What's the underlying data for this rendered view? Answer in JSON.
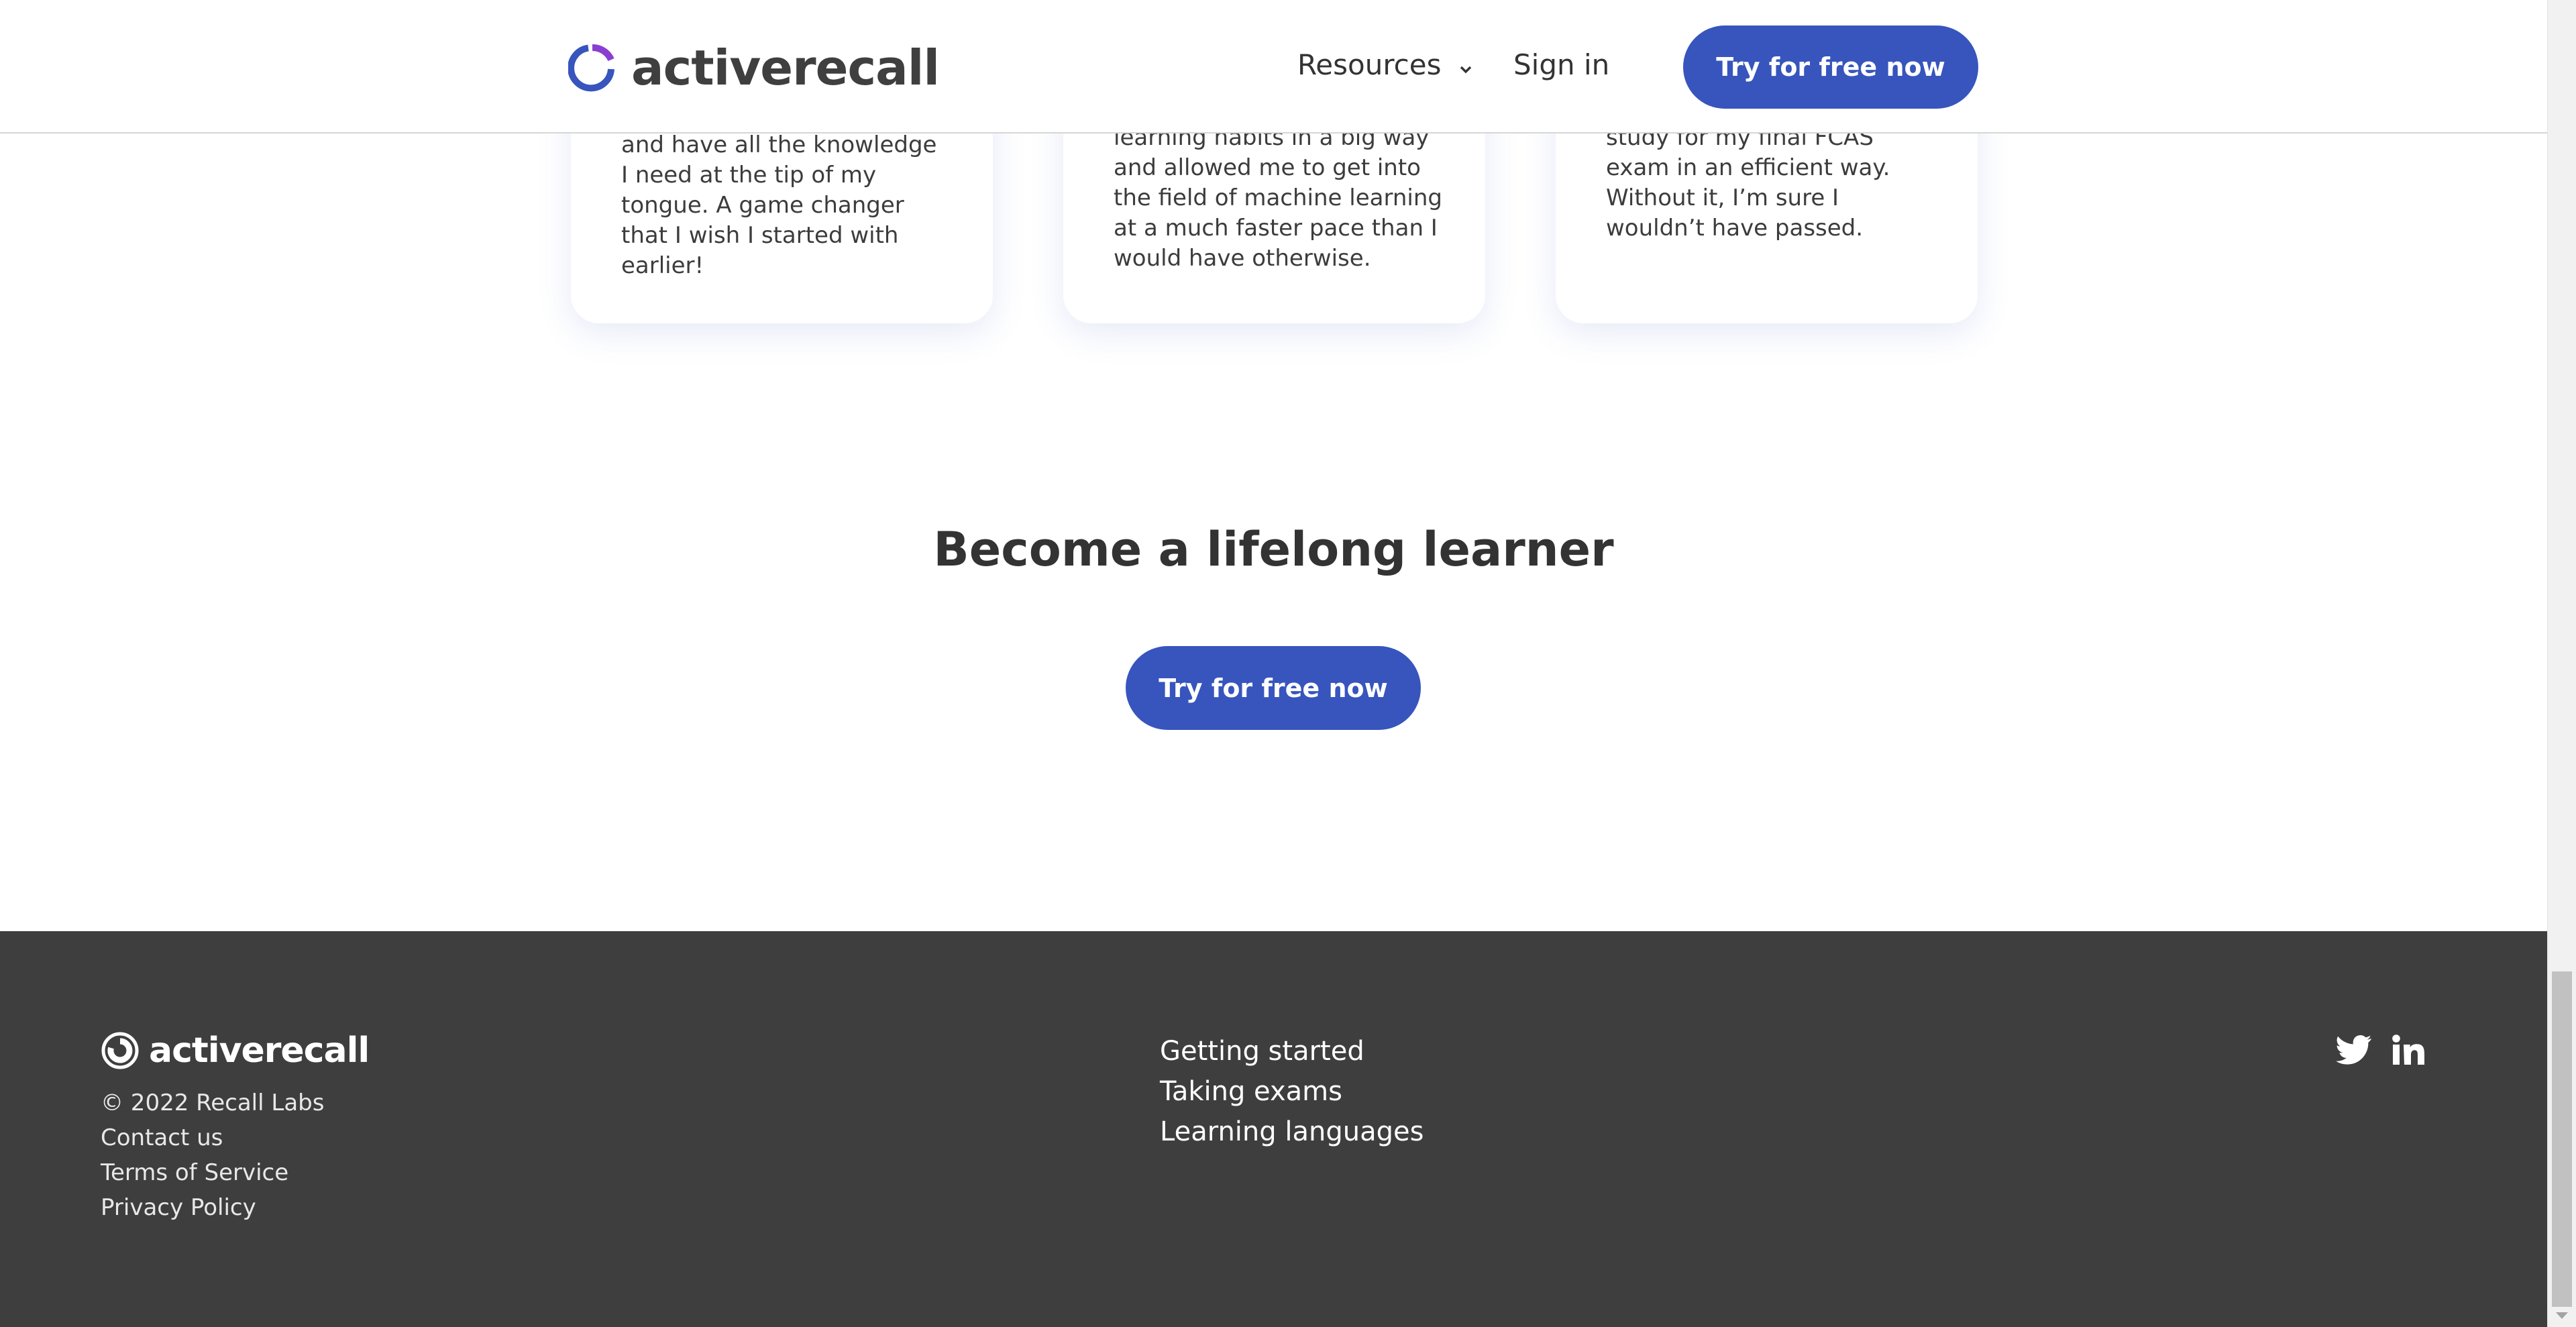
{
  "header": {
    "brand": "activerecall",
    "nav_resources": "Resources",
    "nav_signin": "Sign in",
    "cta": "Try for free now"
  },
  "testimonials": [
    {
      "quote": "and have all the knowledge I need at the tip of my tongue. A game changer that I wish I started with earlier!"
    },
    {
      "quote": "learning habits in a big way and allowed me to get into the field of machine learning at a much faster pace than I would have otherwise."
    },
    {
      "quote": "study for my final FCAS exam in an efficient way. Without it, I’m sure I wouldn’t have passed."
    }
  ],
  "cta_section": {
    "heading": "Become a lifelong learner",
    "button": "Try for free now"
  },
  "footer": {
    "brand": "activerecall",
    "copyright": "© 2022 Recall Labs",
    "contact": "Contact us",
    "terms": "Terms of Service",
    "privacy": "Privacy Policy",
    "links": [
      "Getting started",
      "Taking exams",
      "Learning languages"
    ],
    "social_icons": [
      "twitter-icon",
      "linkedin-icon"
    ]
  },
  "colors": {
    "accent": "#3755bd",
    "logo_purple": "#8a3fd1",
    "footer_bg": "#3e3e3e"
  }
}
